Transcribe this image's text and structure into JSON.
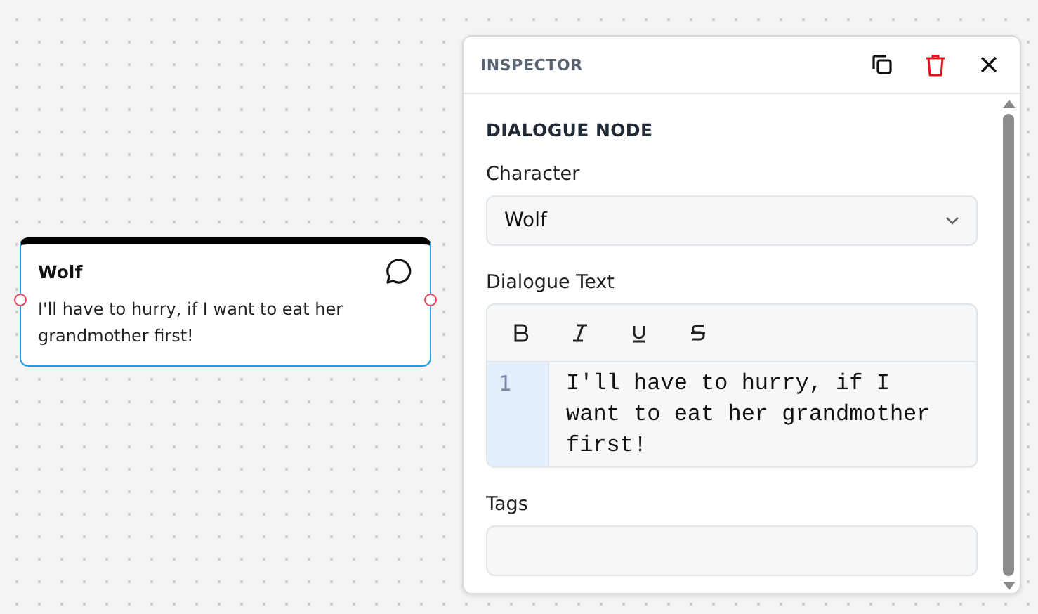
{
  "canvas": {
    "nodes": [
      {
        "kind": "dialogue",
        "character": "Wolf",
        "text": "I'll have to hurry, if I want to eat her grandmother first!",
        "selected": true
      }
    ]
  },
  "inspector": {
    "title": "INSPECTOR",
    "section": "DIALOGUE NODE",
    "fields": [
      {
        "kind": "select",
        "label": "Character",
        "value": "Wolf"
      },
      {
        "kind": "editor",
        "label": "Dialogue Text",
        "line_number": "1",
        "value": "I'll have to hurry, if I want to eat her grandmother first!"
      },
      {
        "kind": "text",
        "label": "Tags"
      }
    ]
  }
}
